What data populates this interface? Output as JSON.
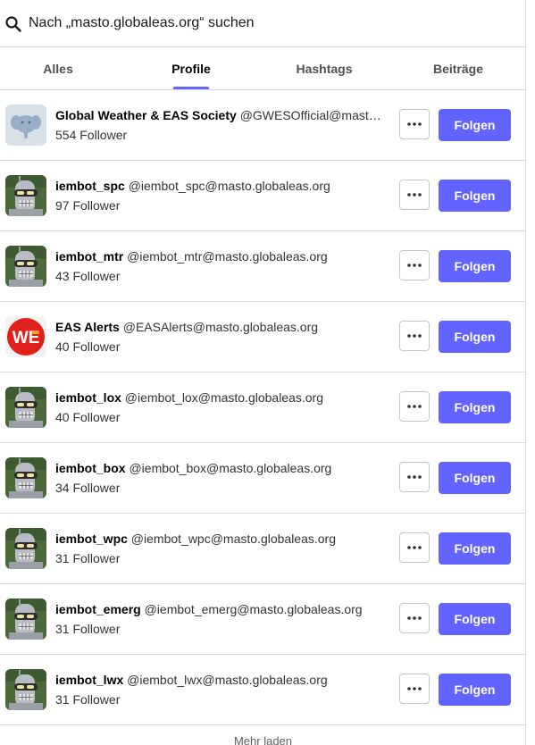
{
  "search": {
    "query": "Nach „masto.globaleas.org“ suchen"
  },
  "tabs": [
    {
      "label": "Alles",
      "active": false
    },
    {
      "label": "Profile",
      "active": true
    },
    {
      "label": "Hashtags",
      "active": false
    },
    {
      "label": "Beiträge",
      "active": false
    }
  ],
  "accent_color": "#6364ff",
  "profiles": [
    {
      "display_name": "Global Weather & EAS Society",
      "handle": "@GWESOfficial@masto.globaleas.org",
      "followers": "554 Follower",
      "avatar": "elephant-avatar",
      "menu_icon": "more-horizontal-icon",
      "follow_label": "Folgen"
    },
    {
      "display_name": "iembot_spc",
      "handle": "@iembot_spc@masto.globaleas.org",
      "followers": "97 Follower",
      "avatar": "robot-avatar",
      "menu_icon": "more-horizontal-icon",
      "follow_label": "Folgen"
    },
    {
      "display_name": "iembot_mtr",
      "handle": "@iembot_mtr@masto.globaleas.org",
      "followers": "43 Follower",
      "avatar": "robot-avatar",
      "menu_icon": "more-horizontal-icon",
      "follow_label": "Folgen"
    },
    {
      "display_name": "EAS Alerts",
      "handle": "@EASAlerts@masto.globaleas.org",
      "followers": "40 Follower",
      "avatar": "eas-logo-avatar",
      "menu_icon": "more-horizontal-icon",
      "follow_label": "Folgen"
    },
    {
      "display_name": "iembot_lox",
      "handle": "@iembot_lox@masto.globaleas.org",
      "followers": "40 Follower",
      "avatar": "robot-avatar",
      "menu_icon": "more-horizontal-icon",
      "follow_label": "Folgen"
    },
    {
      "display_name": "iembot_box",
      "handle": "@iembot_box@masto.globaleas.org",
      "followers": "34 Follower",
      "avatar": "robot-avatar",
      "menu_icon": "more-horizontal-icon",
      "follow_label": "Folgen"
    },
    {
      "display_name": "iembot_wpc",
      "handle": "@iembot_wpc@masto.globaleas.org",
      "followers": "31 Follower",
      "avatar": "robot-avatar",
      "menu_icon": "more-horizontal-icon",
      "follow_label": "Folgen"
    },
    {
      "display_name": "iembot_emerg",
      "handle": "@iembot_emerg@masto.globaleas.org",
      "followers": "31 Follower",
      "avatar": "robot-avatar",
      "menu_icon": "more-horizontal-icon",
      "follow_label": "Folgen"
    },
    {
      "display_name": "iembot_lwx",
      "handle": "@iembot_lwx@masto.globaleas.org",
      "followers": "31 Follower",
      "avatar": "robot-avatar",
      "menu_icon": "more-horizontal-icon",
      "follow_label": "Folgen"
    }
  ],
  "load_more_label": "Mehr laden"
}
